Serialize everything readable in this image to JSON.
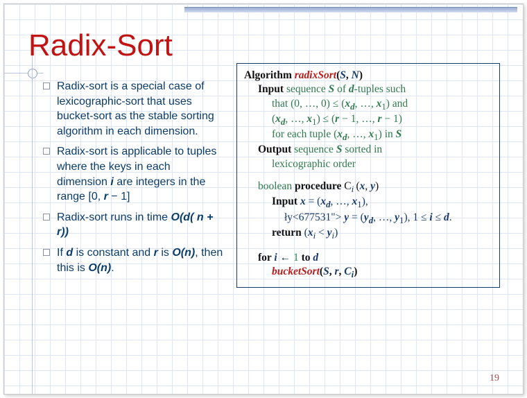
{
  "title": "Radix-Sort",
  "pageNumber": "19",
  "bullets": [
    {
      "pre": "Radix-sort is a special case of lexicographic-sort that uses bucket-sort as the stable sorting algorithm in each dimension."
    },
    {
      "pre": "Radix-sort is applicable to tuples where the keys in each dimension ",
      "i": "i",
      "post1": " are integers in the range ",
      "range_open": "[0, ",
      "r": "r",
      "range_close": " − 1]"
    },
    {
      "pre": "Radix-sort runs in time ",
      "bigO": "O",
      "paren": "(",
      "d": "d",
      "inner_open": "( ",
      "n": "n",
      "plus": " + ",
      "rr": "r",
      "inner_close": "))"
    },
    {
      "pre": "If ",
      "d2": "d",
      "mid1": " is constant and ",
      "r2": "r",
      "mid2": " is ",
      "O1": "O",
      "p1": "(",
      "n1": "n",
      "p2": ")",
      "mid3": ", then this is ",
      "O2": "O",
      "p3": "(",
      "n2": "n",
      "p4": ")",
      "dot": "."
    }
  ],
  "algo": {
    "l1_a": "Algorithm ",
    "l1_name": "radixSort",
    "l1_p": "(",
    "l1_S": "S",
    "l1_c": ", ",
    "l1_N": "N",
    "l1_cp": ")",
    "l2_a": "Input ",
    "l2_b": "sequence ",
    "l2_S": "S",
    "l2_c": " of  ",
    "l2_d": "d",
    "l2_e": "-tuples such",
    "l3_a": "that (0, …, 0) ≤ (",
    "l3_x": "x",
    "l3_d": "d",
    "l3_c": ", …, ",
    "l3_x1": "x",
    "l3_1": "1",
    "l3_b": ") and",
    "l4_a": "(",
    "l4_x": "x",
    "l4_d": "d",
    "l4_c": ", …, ",
    "l4_x1": "x",
    "l4_1": "1",
    "l4_b": ") ≤ (",
    "l4_r": "r",
    "l4_m1": " − 1, …, ",
    "l4_r2": "r",
    "l4_m2": " − 1)",
    "l5_a": "for each tuple (",
    "l5_x": "x",
    "l5_d": "d",
    "l5_c": ", …, ",
    "l5_x1": "x",
    "l5_1": "1",
    "l5_b": ") in ",
    "l5_S": "S",
    "l6_a": "Output ",
    "l6_b": "sequence ",
    "l6_S": "S",
    "l6_c": " sorted in",
    "l7": "lexicographic order",
    "l8_a": "boolean ",
    "l8_b": "procedure ",
    "l8_C": "C",
    "l8_i": "i ",
    "l8_p": "(",
    "l8_x": "x",
    "l8_c": ", ",
    "l8_y": "y",
    "l8_cp": ")",
    "l9_a": "Input ",
    "l9_x": "x",
    "l9_eq": " = (",
    "l9_xd": "x",
    "l9_d": "d",
    "l9_c": ", …, ",
    "l9_x1": "x",
    "l9_1": "1",
    "l9_cp": "),",
    "l10_y": "y",
    "l10_eq": " = (",
    "l10_yd": "y",
    "l10_d": "d",
    "l10_c": ", …, ",
    "l10_y1": "y",
    "l10_1": "1",
    "l10_b": "), 1 ≤ ",
    "l10_i": "i",
    "l10_le": " ≤ ",
    "l10_dd": "d",
    "l10_dot": ".",
    "l11_a": "return ",
    "l11_p": "(",
    "l11_x": "x",
    "l11_i": "i",
    "l11_lt": " < ",
    "l11_y": "y",
    "l11_i2": "i",
    "l11_cp": ")",
    "l12_a": "for ",
    "l12_i": "i",
    "l12_arr": " ← ",
    "l12_1": "1",
    "l12_to": " to ",
    "l12_d": "d",
    "l13_name": "bucketSort",
    "l13_p": "(",
    "l13_S": "S",
    "l13_c1": ", ",
    "l13_r": "r",
    "l13_c2": ", ",
    "l13_C": "C",
    "l13_i": "i",
    "l13_cp": ")"
  }
}
